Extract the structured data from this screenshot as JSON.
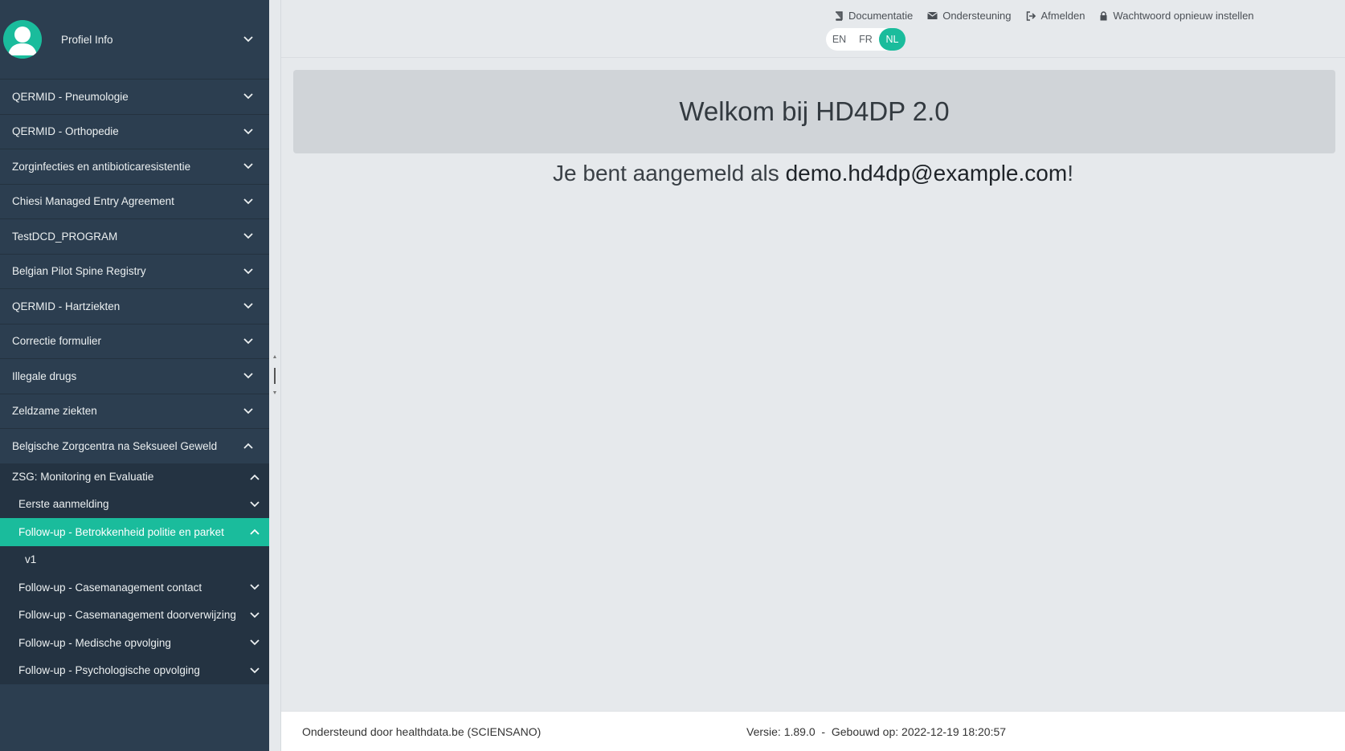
{
  "sidebar": {
    "profile_label": "Profiel Info",
    "items": [
      {
        "label": "QERMID - Pneumologie"
      },
      {
        "label": "QERMID - Orthopedie"
      },
      {
        "label": "Zorginfecties en antibioticaresistentie"
      },
      {
        "label": "Chiesi Managed Entry Agreement"
      },
      {
        "label": "TestDCD_PROGRAM"
      },
      {
        "label": "Belgian Pilot Spine Registry"
      },
      {
        "label": "QERMID - Hartziekten"
      },
      {
        "label": "Correctie formulier"
      },
      {
        "label": "Illegale drugs"
      },
      {
        "label": "Zeldzame ziekten"
      },
      {
        "label": "Belgische Zorgcentra na Seksueel Geweld"
      }
    ],
    "submenu": {
      "header": "ZSG: Monitoring en Evaluatie",
      "items": [
        {
          "label": "Eerste aanmelding"
        },
        {
          "label": "Follow-up - Betrokkenheid politie en parket"
        },
        {
          "label": "v1"
        },
        {
          "label": "Follow-up - Casemanagement contact"
        },
        {
          "label": "Follow-up - Casemanagement doorverwijzing"
        },
        {
          "label": "Follow-up - Medische opvolging"
        },
        {
          "label": "Follow-up - Psychologische opvolging"
        }
      ]
    }
  },
  "header": {
    "links": {
      "documentation": "Documentatie",
      "support": "Ondersteuning",
      "logout": "Afmelden",
      "reset_password": "Wachtwoord opnieuw instellen"
    },
    "languages": [
      "EN",
      "FR",
      "NL"
    ],
    "active_language": "NL"
  },
  "main": {
    "welcome": "Welkom bij HD4DP 2.0",
    "logged_in_prefix": "Je bent aangemeld als ",
    "email": "demo.hd4dp@example.com",
    "logged_in_suffix": "!"
  },
  "footer": {
    "supported_by": "Ondersteund door healthdata.be (SCIENSANO)",
    "version_label": "Versie: 1.89.0",
    "separator": "  -  ",
    "build_label": "Gebouwd op: 2022-12-19 18:20:57"
  },
  "colors": {
    "sidebar_bg": "#2c3e50",
    "accent": "#1abc9c",
    "main_bg": "#e6e9ec"
  }
}
